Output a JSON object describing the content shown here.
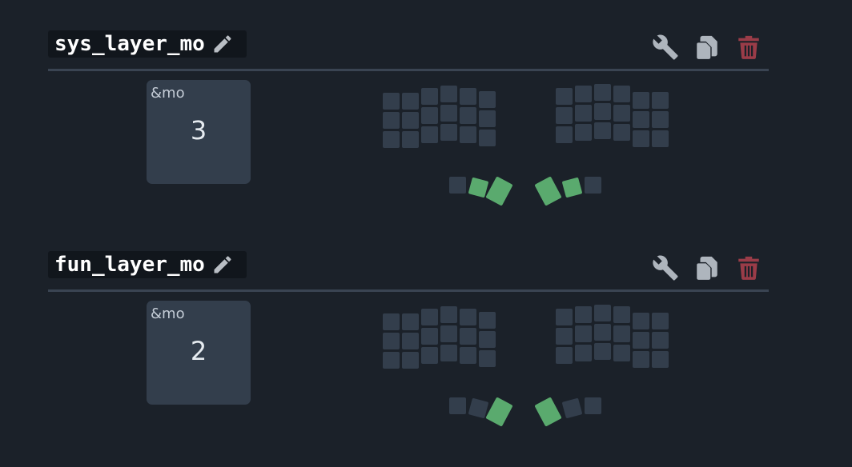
{
  "combos": [
    {
      "name": "sys_layer_mo",
      "behavior": {
        "name": "&mo",
        "param": "3"
      },
      "selected_keys": [
        33,
        34,
        35,
        36
      ]
    },
    {
      "name": "fun_layer_mo",
      "behavior": {
        "name": "&mo",
        "param": "2"
      },
      "selected_keys": [
        34,
        35
      ]
    }
  ],
  "icons": {
    "edit": "pencil-icon",
    "configure": "wrench-icon",
    "copy": "copy-icon",
    "delete": "trash-icon"
  },
  "colors": {
    "background": "#1b2129",
    "key": "#333e4c",
    "key_selected": "#5aaa6e",
    "delete": "#9a3c48",
    "icon": "#aeb5bd"
  }
}
